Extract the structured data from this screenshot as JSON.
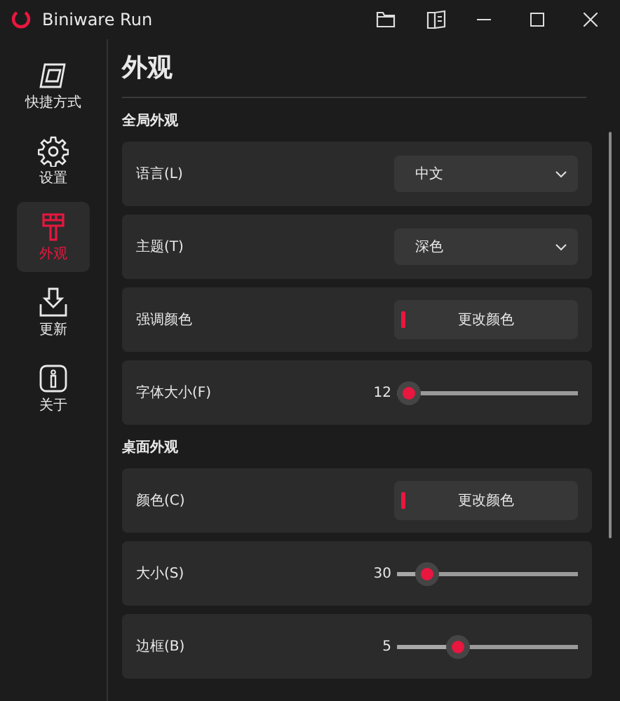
{
  "window": {
    "title": "Biniware Run"
  },
  "sidebar": {
    "items": [
      {
        "label": "快捷方式",
        "selected": false
      },
      {
        "label": "设置",
        "selected": false
      },
      {
        "label": "外观",
        "selected": true
      },
      {
        "label": "更新",
        "selected": false
      },
      {
        "label": "关于",
        "selected": false
      }
    ]
  },
  "page": {
    "title": "外观",
    "sections": [
      {
        "title": "全局外观",
        "rows": [
          {
            "kind": "dropdown",
            "label": "语言(L)",
            "value": "中文"
          },
          {
            "kind": "dropdown",
            "label": "主题(T)",
            "value": "深色"
          },
          {
            "kind": "color",
            "label": "强调颜色",
            "button": "更改颜色",
            "color": "#e8173f"
          },
          {
            "kind": "slider",
            "label": "字体大小(F)",
            "reading": "12",
            "level": 0.05
          }
        ]
      },
      {
        "title": "桌面外观",
        "rows": [
          {
            "kind": "color",
            "label": "颜色(C)",
            "button": "更改颜色",
            "color": "#e8173f"
          },
          {
            "kind": "slider",
            "label": "大小(S)",
            "reading": "30",
            "level": 0.17
          },
          {
            "kind": "slider",
            "label": "边框(B)",
            "reading": "5",
            "level": 0.34
          }
        ]
      }
    ]
  }
}
